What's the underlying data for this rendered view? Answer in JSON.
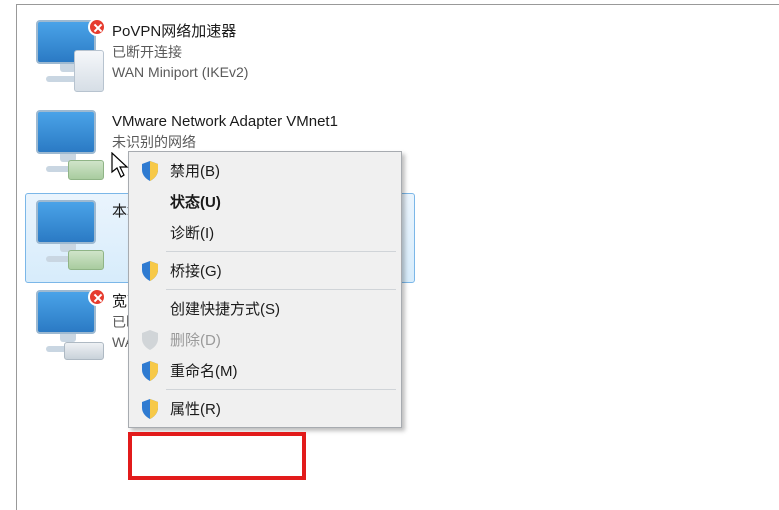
{
  "connections": [
    {
      "title": "PoVPN网络加速器",
      "status": "已断开连接",
      "device": "WAN Miniport (IKEv2)",
      "iconDevice": "modem",
      "error": true,
      "selected": false
    },
    {
      "title": "VMware Network Adapter VMnet1",
      "status": "未识别的网络",
      "device": "",
      "iconDevice": "plug",
      "error": false,
      "selected": false
    },
    {
      "title": "本地连接",
      "status": "",
      "device": "",
      "iconDevice": "plug",
      "error": false,
      "selected": true
    },
    {
      "title": "宽带连接",
      "status": "已断开连接",
      "device": "WAN Miniport (PPPOE)",
      "iconDevice": "dial",
      "error": true,
      "selected": false
    }
  ],
  "menu": {
    "disable": "禁用(B)",
    "status": "状态(U)",
    "diagnose": "诊断(I)",
    "bridge": "桥接(G)",
    "shortcut": "创建快捷方式(S)",
    "delete": "删除(D)",
    "rename": "重命名(M)",
    "properties": "属性(R)"
  }
}
